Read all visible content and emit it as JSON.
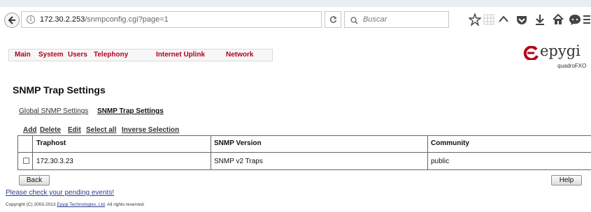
{
  "browser": {
    "url_host": "172.30.2.253",
    "url_path": "/snmpconfig.cgi?page=1",
    "search_placeholder": "Buscar"
  },
  "nav": {
    "items": [
      "Main",
      "System",
      "Users",
      "Telephony",
      "Internet Uplink",
      "Network"
    ]
  },
  "brand": {
    "logo_text": "epygi",
    "model": "quadroFXO",
    "accent": "#b3001b"
  },
  "page": {
    "title": "SNMP Trap Settings",
    "sublinks": [
      "Global SNMP Settings",
      "SNMP Trap Settings"
    ]
  },
  "actions": [
    "Add",
    "Delete",
    "Edit",
    "Select all",
    "Inverse Selection"
  ],
  "table": {
    "headers": [
      "Traphost",
      "SNMP Version",
      "Community"
    ],
    "rows": [
      {
        "traphost": "172.30.3.23",
        "version": "SNMP v2 Traps",
        "community": "public",
        "checked": false
      }
    ]
  },
  "buttons": {
    "back": "Back",
    "help": "Help"
  },
  "footer": {
    "events_link": "Please check your pending events!",
    "copyright_prefix": "Copyright (C) 2003-2013 ",
    "copyright_company": "Epygi Technologies, Ltd",
    "copyright_suffix": ". All rights reserved."
  }
}
